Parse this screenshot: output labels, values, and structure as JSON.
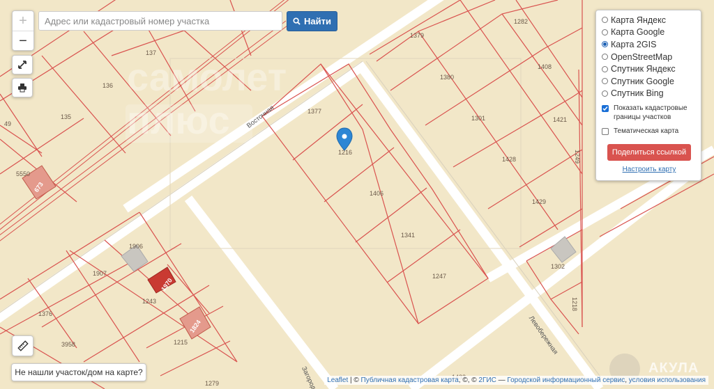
{
  "search": {
    "placeholder": "Адрес или кадастровый номер участка",
    "button_label": "Найти"
  },
  "zoom": {
    "in_label": "+",
    "out_label": "−"
  },
  "layers": {
    "options": [
      {
        "label": "Карта Яндекс",
        "selected": false
      },
      {
        "label": "Карта Google",
        "selected": false
      },
      {
        "label": "Карта 2GIS",
        "selected": true
      },
      {
        "label": "OpenStreetMap",
        "selected": false
      },
      {
        "label": "Спутник Яндекс",
        "selected": false
      },
      {
        "label": "Спутник Google",
        "selected": false
      },
      {
        "label": "Спутник Bing",
        "selected": false
      }
    ],
    "show_cadastral": {
      "label": "Показать кадастровые границы участков",
      "checked": true
    },
    "thematic": {
      "label": "Тематическая карта",
      "checked": false
    },
    "share_label": "Поделиться ссылкой",
    "configure_label": "Настроить карту"
  },
  "not_found_label": "Не нашли участок/дом на карте?",
  "attribution": {
    "leaflet": "Leaflet",
    "sep1": " | © ",
    "pkk": "Публичная кадастровая карта",
    "sep2": ", ©, © ",
    "gis": "2ГИС",
    "sep3": " — ",
    "gis_terms": "Городской информационный сервис",
    "sep4": ", ",
    "terms": "условия использования"
  },
  "map": {
    "streets": [
      "Восточная",
      "Левобережная",
      "Загородная"
    ],
    "parcels": [
      "1379",
      "1282",
      "137",
      "1380",
      "1408",
      "136",
      "1377",
      "1301",
      "1421",
      "135",
      "1249",
      "1428",
      "1216",
      "5550",
      "1406",
      "1429",
      "1341",
      "1906",
      "1907",
      "1302",
      "1247",
      "1243",
      "1218",
      "1376",
      "1215",
      "3958",
      "1279",
      "1433",
      "49"
    ],
    "building_labels": [
      "673",
      "1970",
      "1824"
    ],
    "watermark_logo": "АКУЛА",
    "faded_logo": "самолет плюс"
  },
  "colors": {
    "map_bg": "#f2e7c8",
    "road": "#ffffff",
    "boundary": "#d9534f",
    "marker": "#2d86d4",
    "search_button": "#2f6fb2",
    "share_button": "#d9534f"
  },
  "icons": {
    "search": "search-icon",
    "fullscreen": "expand-icon",
    "print": "print-icon",
    "ruler": "ruler-icon",
    "marker": "map-marker-icon"
  }
}
